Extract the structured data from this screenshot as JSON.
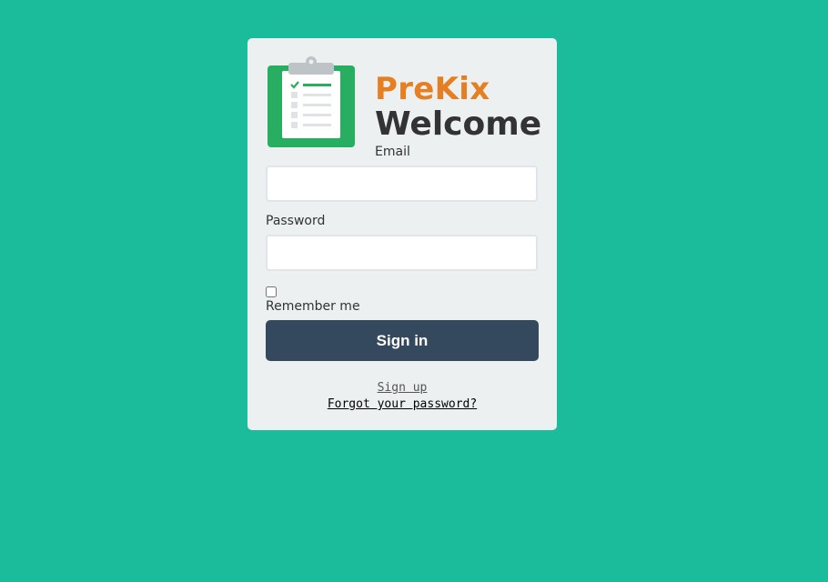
{
  "brand": {
    "name": "PreKix",
    "welcome": "Welcome",
    "logo_icon": "clipboard-checklist-icon",
    "colors": {
      "background": "#1abc9c",
      "card": "#ecf0f1",
      "brand": "#e67e22",
      "button": "#34495e",
      "logo_green": "#27ae60"
    }
  },
  "form": {
    "email_label": "Email",
    "email_value": "",
    "password_label": "Password",
    "password_value": "",
    "remember_label": "Remember me",
    "remember_checked": false,
    "submit_label": "Sign in"
  },
  "links": {
    "signup": "Sign up",
    "forgot": "Forgot your password?"
  }
}
